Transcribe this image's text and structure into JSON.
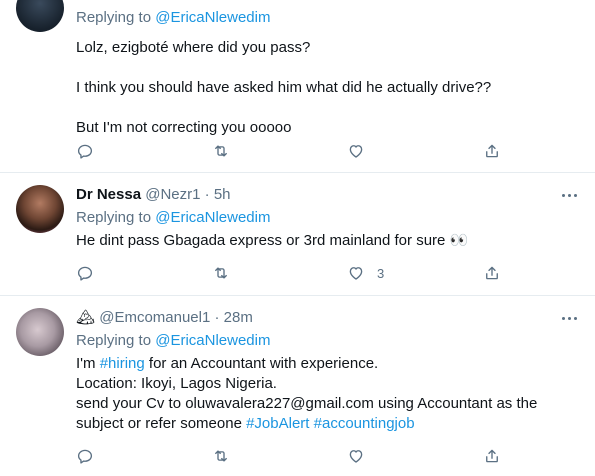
{
  "tweets": [
    {
      "reply_prefix": "Replying to ",
      "reply_to": "@EricaNlewedim",
      "lines": [
        "Lolz, ezigboté where did you pass?",
        "",
        "I think you should have asked him what did he actually drive??",
        "",
        "But I'm not correcting you ooooo"
      ],
      "like_count": ""
    },
    {
      "display_name": "Dr Nessa",
      "handle": "@Nezr1",
      "separator": "·",
      "time": "5h",
      "reply_prefix": "Replying to ",
      "reply_to": "@EricaNlewedim",
      "text": "He dint pass Gbagada express or 3rd mainland for sure 👀",
      "like_count": "3"
    },
    {
      "name_emoji": "🏔",
      "handle": "@Emcomanuel1",
      "separator": "·",
      "time": "28m",
      "reply_prefix": "Replying to ",
      "reply_to": "@EricaNlewedim",
      "line1_pre": "I'm ",
      "line1_tag": "#hiring",
      "line1_post": " for an Accountant with experience.",
      "line2": "Location: Ikoyi, Lagos Nigeria.",
      "line3": "send your Cv to oluwavalera227@gmail.com using Accountant as the",
      "line4_pre": "subject or refer someone ",
      "line4_tag1": "#JobAlert",
      "line4_sep": " ",
      "line4_tag2": "#accountingjob",
      "like_count": ""
    }
  ],
  "icons": [
    "reply-icon",
    "retweet-icon",
    "like-icon",
    "share-icon",
    "more-icon"
  ],
  "colors": {
    "text": "#0f1419",
    "muted": "#5b7083",
    "link": "#1b95e0",
    "divider": "#e6ecf0"
  }
}
